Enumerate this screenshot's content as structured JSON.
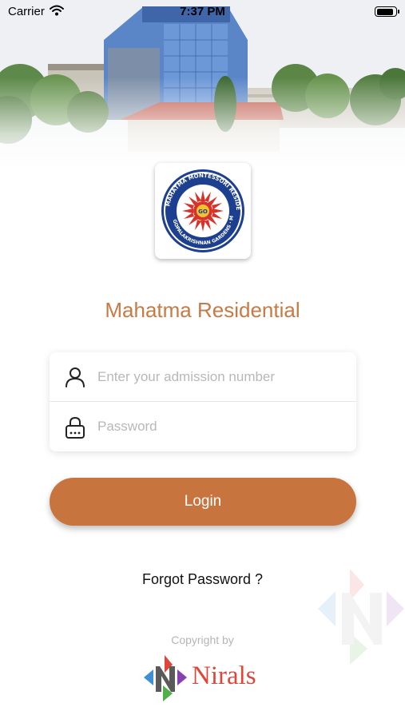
{
  "status_bar": {
    "carrier": "Carrier",
    "time": "7:37 PM",
    "battery_level": 0.9
  },
  "header": {
    "logo_text": {
      "outer_ring": "MAHATMA MONTESSORI RESIDENTIAL SCHOOL",
      "lower_ring": "GOPALAKRISHNAN GARDENS · MADURAI",
      "center": "GO"
    },
    "school_name": "Mahatma Residential"
  },
  "login_form": {
    "admission_field": {
      "placeholder": "Enter your admission number",
      "value": "",
      "icon": "user-icon"
    },
    "password_field": {
      "placeholder": "Password",
      "value": "",
      "icon": "lock-icon"
    },
    "login_label": "Login",
    "forgot_label": "Forgot Password ?"
  },
  "footer": {
    "copyright_label": "Copyright by",
    "brand_name": "Nirals"
  },
  "colors": {
    "accent": "#c8743f",
    "title": "#c87a44",
    "brand_red": "#e0453a"
  }
}
